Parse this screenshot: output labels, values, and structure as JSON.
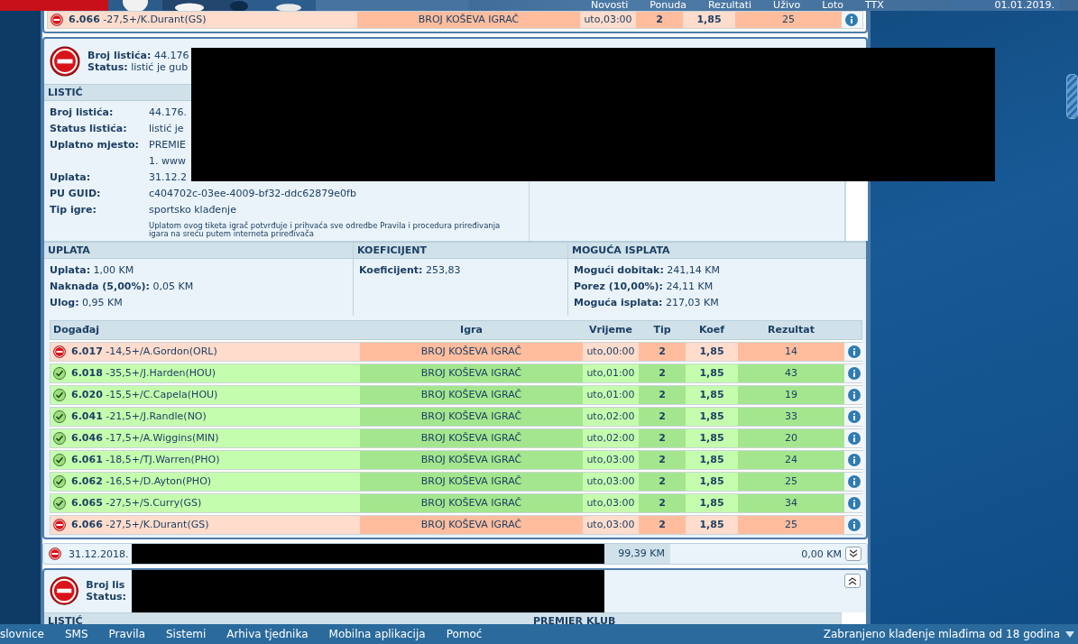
{
  "header": {
    "nav": [
      "Novosti",
      "Ponuda",
      "Rezultati",
      "Uživo",
      "Loto",
      "TTX"
    ],
    "date": "01.01.2019."
  },
  "previous_card": {
    "last_row": {
      "won": false,
      "event": "**6.066** -27,5+/K.Durant(GS)",
      "game": "BROJ KOŠEVA IGRAČ",
      "time": "uto,03:00",
      "tip": "2",
      "koef": "1,85",
      "result": "25"
    }
  },
  "ticket": {
    "won": false,
    "number_label": "Broj listića:",
    "number_value": "44.176",
    "status_label": "Status:",
    "status_value": "listić je gub",
    "listic": {
      "title": "LISTIĆ",
      "fields": [
        {
          "label": "Broj listića:",
          "lines": [
            "44.176."
          ]
        },
        {
          "label": "Status listića:",
          "lines": [
            "listić je"
          ]
        },
        {
          "label": "Uplatno mjesto:",
          "lines": [
            "PREMIE",
            "1. www"
          ]
        },
        {
          "label": "Uplata:",
          "lines": [
            "31.12.2"
          ]
        },
        {
          "label": "PU GUID:",
          "lines": [
            "c404702c-03ee-4009-bf32-ddc62879e0fb"
          ]
        },
        {
          "label": "Tip igre:",
          "lines": [
            "sportsko klađenje"
          ]
        }
      ],
      "notice": "Uplatom ovog tiketa igrač potvrđuje i prihvaća sve odredbe Pravila i procedura priređivanja igara na sreću putem interneta priređivača"
    },
    "sections": [
      {
        "title": "UPLATA",
        "lines": [
          {
            "label": "Uplata:",
            "value": "1,00 KM"
          },
          {
            "label": "Naknada (5,00%):",
            "value": "0,05 KM"
          },
          {
            "label": "Ulog:",
            "value": "0,95 KM"
          }
        ]
      },
      {
        "title": "KOEFICIJENT",
        "lines": [
          {
            "label": "Koeficijent:",
            "value": "253,83"
          }
        ]
      },
      {
        "title": "MOGUĆA ISPLATA",
        "lines": [
          {
            "label": "Mogući dobitak:",
            "value": "241,14 KM"
          },
          {
            "label": "Porez (10,00%):",
            "value": "24,11 KM"
          },
          {
            "label": "Moguća isplata:",
            "value": "217,03 KM"
          }
        ]
      }
    ],
    "table": {
      "columns": [
        "Događaj",
        "Igra",
        "Vrijeme",
        "Tip",
        "Koef",
        "Rezultat"
      ],
      "rows": [
        {
          "won": false,
          "event": "**6.017** -14,5+/A.Gordon(ORL)",
          "game": "BROJ KOŠEVA IGRAČ",
          "time": "uto,00:00",
          "tip": "2",
          "koef": "1,85",
          "result": "14"
        },
        {
          "won": true,
          "event": "**6.018** -35,5+/J.Harden(HOU)",
          "game": "BROJ KOŠEVA IGRAČ",
          "time": "uto,01:00",
          "tip": "2",
          "koef": "1,85",
          "result": "43"
        },
        {
          "won": true,
          "event": "**6.020** -15,5+/C.Capela(HOU)",
          "game": "BROJ KOŠEVA IGRAČ",
          "time": "uto,01:00",
          "tip": "2",
          "koef": "1,85",
          "result": "19"
        },
        {
          "won": true,
          "event": "**6.041** -21,5+/J.Randle(NO)",
          "game": "BROJ KOŠEVA IGRAČ",
          "time": "uto,02:00",
          "tip": "2",
          "koef": "1,85",
          "result": "33"
        },
        {
          "won": true,
          "event": "**6.046** -17,5+/A.Wiggins(MIN)",
          "game": "BROJ KOŠEVA IGRAČ",
          "time": "uto,02:00",
          "tip": "2",
          "koef": "1,85",
          "result": "20"
        },
        {
          "won": true,
          "event": "**6.061** -18,5+/TJ.Warren(PHO)",
          "game": "BROJ KOŠEVA IGRAČ",
          "time": "uto,03:00",
          "tip": "2",
          "koef": "1,85",
          "result": "24"
        },
        {
          "won": true,
          "event": "**6.062** -16,5+/D.Ayton(PHO)",
          "game": "BROJ KOŠEVA IGRAČ",
          "time": "uto,03:00",
          "tip": "2",
          "koef": "1,85",
          "result": "25"
        },
        {
          "won": true,
          "event": "**6.065** -27,5+/S.Curry(GS)",
          "game": "BROJ KOŠEVA IGRAČ",
          "time": "uto,03:00",
          "tip": "2",
          "koef": "1,85",
          "result": "34"
        },
        {
          "won": false,
          "event": "**6.066** -27,5+/K.Durant(GS)",
          "game": "BROJ KOŠEVA IGRAČ",
          "time": "uto,03:00",
          "tip": "2",
          "koef": "1,85",
          "result": "25"
        }
      ]
    }
  },
  "collapsed_ticket": {
    "won": false,
    "expanded": false,
    "date": "31.12.2018.",
    "amount": "99,39 KM",
    "payout": "0,00 KM"
  },
  "next_ticket": {
    "won": false,
    "expanded": true,
    "number_label": "Broj lis",
    "status_label": "Status:",
    "sections": [
      "LISTIĆ",
      "PREMIER KLUB"
    ]
  },
  "footer": {
    "links": [
      "slovnice",
      "SMS",
      "Pravila",
      "Sistemi",
      "Arhiva tjednika",
      "Mobilna aplikacija",
      "Pomoć"
    ],
    "notice": "Zabranjeno klađenje mlađima od 18 godina"
  }
}
